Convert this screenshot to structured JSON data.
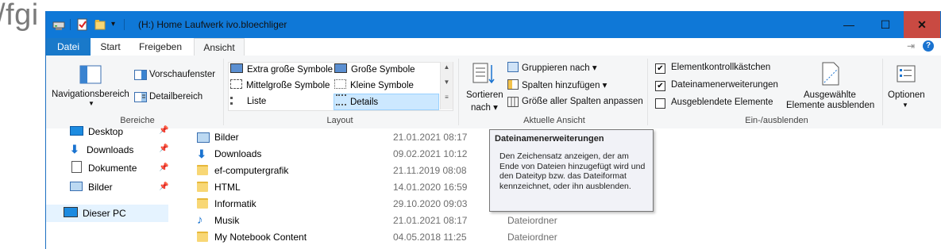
{
  "background_text": "/fgi",
  "window": {
    "title": "(H:) Home Laufwerk ivo.bloechliger",
    "controls": {
      "minimize": "—",
      "maximize": "☐",
      "close": "✕"
    }
  },
  "tabs": [
    {
      "label": "Datei"
    },
    {
      "label": "Start"
    },
    {
      "label": "Freigeben"
    },
    {
      "label": "Ansicht"
    }
  ],
  "ribbon": {
    "bereiche": {
      "navigationsbereich": "Navigationsbereich",
      "vorschaufenster": "Vorschaufenster",
      "detailbereich": "Detailbereich",
      "label": "Bereiche"
    },
    "layout": {
      "options": [
        "Extra große Symbole",
        "Große Symbole",
        "Mittelgroße Symbole",
        "Kleine Symbole",
        "Liste",
        "Details"
      ],
      "selected": "Details",
      "label": "Layout"
    },
    "aktuelle_ansicht": {
      "sortieren_line1": "Sortieren",
      "sortieren_line2": "nach",
      "gruppieren": "Gruppieren nach",
      "spalten": "Spalten hinzufügen",
      "groesse": "Größe aller Spalten anpassen",
      "label": "Aktuelle Ansicht"
    },
    "ein_ausblenden": {
      "elementkontroll": {
        "label": "Elementkontrollkästchen",
        "checked": true
      },
      "dateinamen": {
        "label": "Dateinamenerweiterungen",
        "checked": true
      },
      "ausgeblendete": {
        "label": "Ausgeblendete Elemente",
        "checked": false
      },
      "ausgewaehlte_line1": "Ausgewählte",
      "ausgewaehlte_line2": "Elemente ausblenden",
      "label": "Ein-/ausblenden"
    },
    "optionen": "Optionen"
  },
  "nav": [
    {
      "label": "Desktop"
    },
    {
      "label": "Downloads"
    },
    {
      "label": "Dokumente"
    },
    {
      "label": "Bilder"
    },
    {
      "label": "Dieser PC"
    }
  ],
  "files": [
    {
      "name": "Bilder",
      "date": "21.01.2021 08:17",
      "type": ""
    },
    {
      "name": "Downloads",
      "date": "09.02.2021 10:12",
      "type": ""
    },
    {
      "name": "ef-computergrafik",
      "date": "21.11.2019 08:08",
      "type": ""
    },
    {
      "name": "HTML",
      "date": "14.01.2020 16:59",
      "type": ""
    },
    {
      "name": "Informatik",
      "date": "29.10.2020 09:03",
      "type": ""
    },
    {
      "name": "Musik",
      "date": "21.01.2021 08:17",
      "type": "Dateiordner"
    },
    {
      "name": "My Notebook Content",
      "date": "04.05.2018 11:25",
      "type": "Dateiordner"
    }
  ],
  "tooltip": {
    "title": "Dateinamenerweiterungen",
    "body": "Den Zeichensatz anzeigen, der am Ende von Dateien hinzugefügt wird und den Dateityp bzw. das Dateiformat kennzeichnet, oder ihn ausblenden."
  },
  "colors": {
    "titlebar": "#0f78d7",
    "file_tab": "#1979ca",
    "close": "#c94a42",
    "selection": "#cce8ff"
  }
}
